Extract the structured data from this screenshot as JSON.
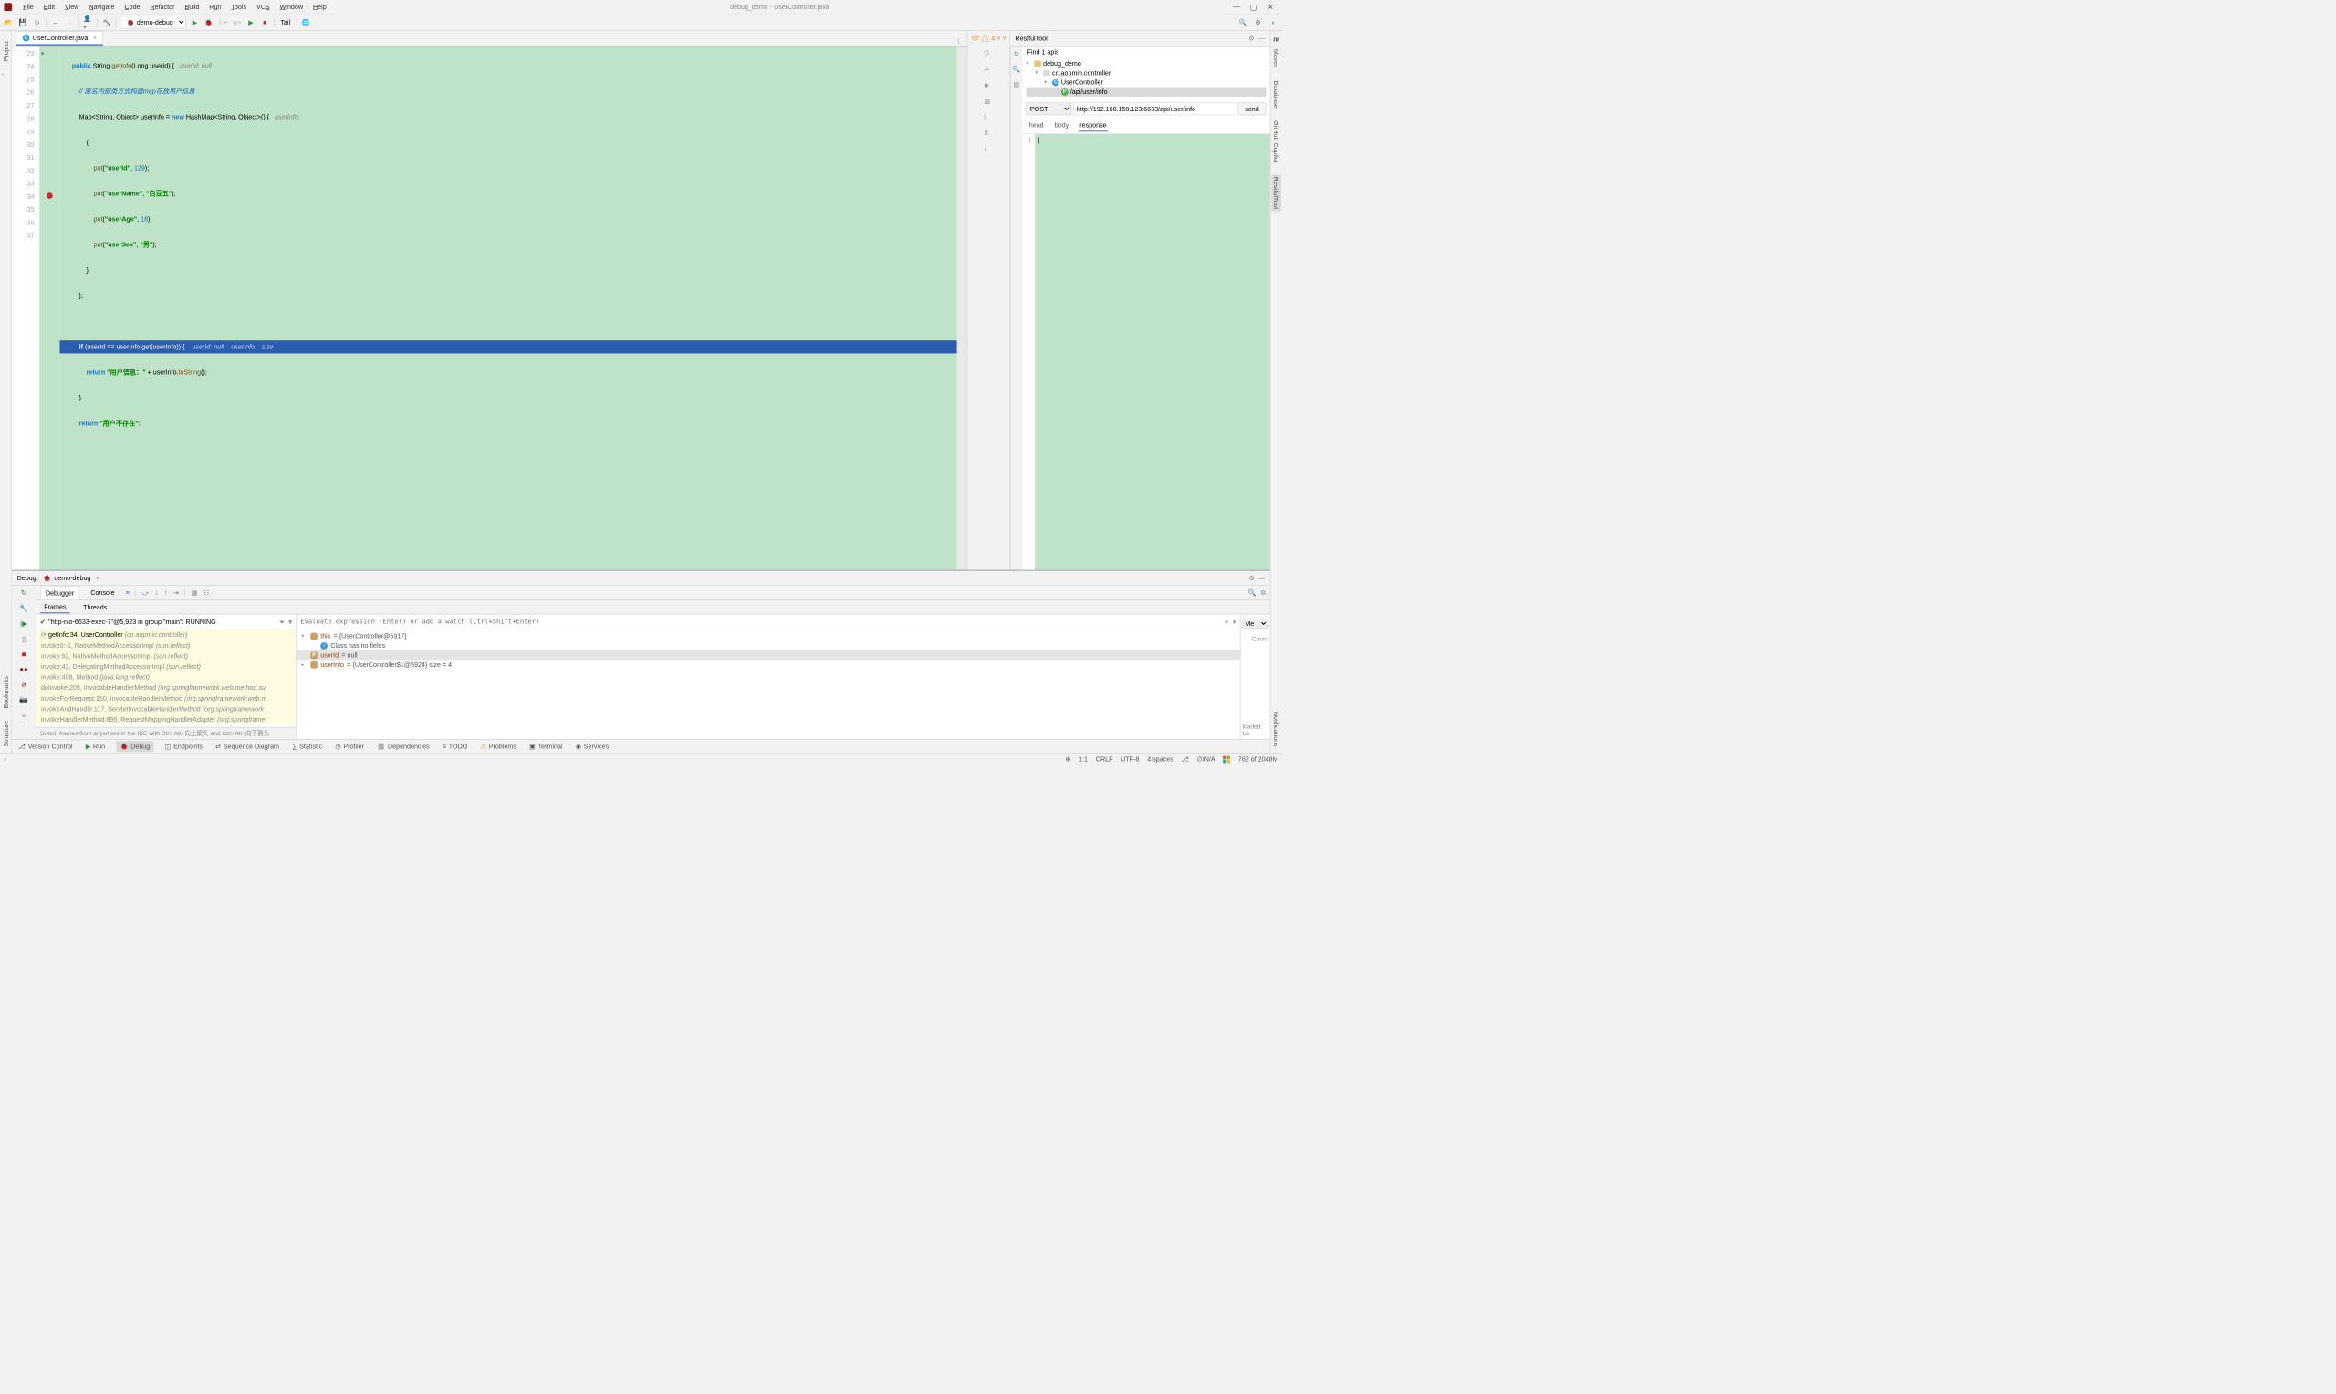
{
  "menubar": {
    "items": [
      "File",
      "Edit",
      "View",
      "Navigate",
      "Code",
      "Refactor",
      "Build",
      "Run",
      "Tools",
      "VCS",
      "Window",
      "Help"
    ],
    "title": "debug_demo - UserController.java"
  },
  "toolbar": {
    "config": "demo-debug",
    "tail": "Tail"
  },
  "tab": {
    "file": "UserController.java",
    "icon": "C"
  },
  "editor": {
    "lines": [
      23,
      24,
      25,
      26,
      27,
      28,
      29,
      30,
      31,
      32,
      33,
      34,
      35,
      36,
      37
    ],
    "breakpoint_line": 34,
    "warn_count": "4",
    "code": {
      "l23_kw": "public",
      "l23_ty": "String",
      "l23_fn": "getInfo",
      "l23_sig": "(Long userId) {",
      "l23_hint": "userId: null",
      "l24": "// 匿名内部类方式构建map存放用户信息",
      "l25_a": "Map<String, Object> userInfo = ",
      "l25_new": "new",
      "l25_b": " HashMap<String, Object>() {",
      "l25_hint": "userInfo:",
      "l26": "{",
      "l27_fn": "put",
      "l27_k": "\"userId\"",
      "l27_v": "129",
      "l27_tail": ");",
      "l28_fn": "put",
      "l28_k": "\"userName\"",
      "l28_v": "\"白豆五\"",
      "l28_tail": ");",
      "l29_fn": "put",
      "l29_k": "\"userAge\"",
      "l29_v": "18",
      "l29_tail": ");",
      "l30_fn": "put",
      "l30_k": "\"userSex\"",
      "l30_v": "\"男\"",
      "l30_tail": ");",
      "l31": "}",
      "l32": "};",
      "l33": "",
      "l34_kw": "if",
      "l34_a": " (userId == userInfo.",
      "l34_fn": "get",
      "l34_b": "(userInfo)) {",
      "l34_h1": "userId: null",
      "l34_h2": "userInfo:",
      "l34_h3": "size",
      "l35_kw": "return",
      "l35_s": " \"用户信息：\" ",
      "l35_a": "+ userInfo.",
      "l35_fn": "toString",
      "l35_b": "();",
      "l36": "}",
      "l37_kw": "return",
      "l37_s": " \"用户不存在\":"
    }
  },
  "rest": {
    "title": "RestfulTool",
    "find": "Find 1 apis",
    "tree": {
      "root": "debug_demo",
      "pkg": "cn.aopmin.controller",
      "cls": "UserController",
      "api": "/api/user/info"
    },
    "method": "POST",
    "url": "http://192.168.150.123:6633/api/user/info",
    "send": "send",
    "tabs": {
      "head": "head",
      "body": "body",
      "response": "response"
    },
    "resp_line": "1"
  },
  "left_tools": [
    "Project",
    "Bookmarks",
    "Structure"
  ],
  "right_tools": [
    "Maven",
    "Database",
    "GitHub Copilot",
    "RestfulTool",
    "Notifications"
  ],
  "debug": {
    "title": "Debug:",
    "config": "demo-debug",
    "tabs": {
      "debugger": "Debugger",
      "console": "Console"
    },
    "ft": {
      "frames": "Frames",
      "threads": "Threads"
    },
    "thread": "\"http-nio-6633-exec-7\"@5,923 in group \"main\": RUNNING",
    "frames": [
      {
        "m": "getInfo:34, UserController ",
        "p": "(cn.aopmin.controller)",
        "top": true
      },
      {
        "m": "invoke0:-1, NativeMethodAccessorImpl ",
        "p": "(sun.reflect)"
      },
      {
        "m": "invoke:62, NativeMethodAccessorImpl ",
        "p": "(sun.reflect)"
      },
      {
        "m": "invoke:43, DelegatingMethodAccessorImpl ",
        "p": "(sun.reflect)"
      },
      {
        "m": "invoke:498, Method ",
        "p": "(java.lang.reflect)"
      },
      {
        "m": "doInvoke:205, InvocableHandlerMethod ",
        "p": "(org.springframework.web.method.su"
      },
      {
        "m": "invokeForRequest:150, InvocableHandlerMethod ",
        "p": "(org.springframework.web.m"
      },
      {
        "m": "invokeAndHandle:117, ServletInvocableHandlerMethod ",
        "p": "(org.springframework"
      },
      {
        "m": "invokeHandlerMethod:895, RequestMappingHandlerAdapter ",
        "p": "(org.springframe"
      }
    ],
    "hint": "Switch frames from anywhere in the IDE with Ctrl+Alt+向上箭头 and Ctrl+Alt+向下箭头",
    "eval_ph": "Evaluate expression (Enter) or add a watch (Ctrl+Shift+Enter)",
    "mem": "Me",
    "vars": [
      {
        "ind": 1,
        "ch": "▾",
        "ic": "v",
        "name": "this",
        "val": " = {UserController@5917}"
      },
      {
        "ind": 2,
        "ch": "",
        "ic": "i",
        "name": "",
        "val": "Class has no fields"
      },
      {
        "ind": 1,
        "ch": "",
        "ic": "p",
        "name": "userId",
        "val": " = null",
        "sel": true
      },
      {
        "ind": 1,
        "ch": "▸",
        "ic": "v",
        "name": "userInfo",
        "val": " = {UserController$1@5924}  size = 4"
      }
    ],
    "rpane": {
      "count": "Count",
      "loaded": "loaded. Lo"
    }
  },
  "bottom": {
    "items": [
      "Version Control",
      "Run",
      "Debug",
      "Endpoints",
      "Sequence Diagram",
      "Statistic",
      "Profiler",
      "Dependencies",
      "TODO",
      "Problems",
      "Terminal",
      "Services"
    ]
  },
  "status": {
    "pos": "1:1",
    "le": "CRLF",
    "enc": "UTF-8",
    "indent": "4 spaces",
    "git": "⎇",
    "na": "∅/N/A",
    "mem": "762 of 2048M"
  }
}
